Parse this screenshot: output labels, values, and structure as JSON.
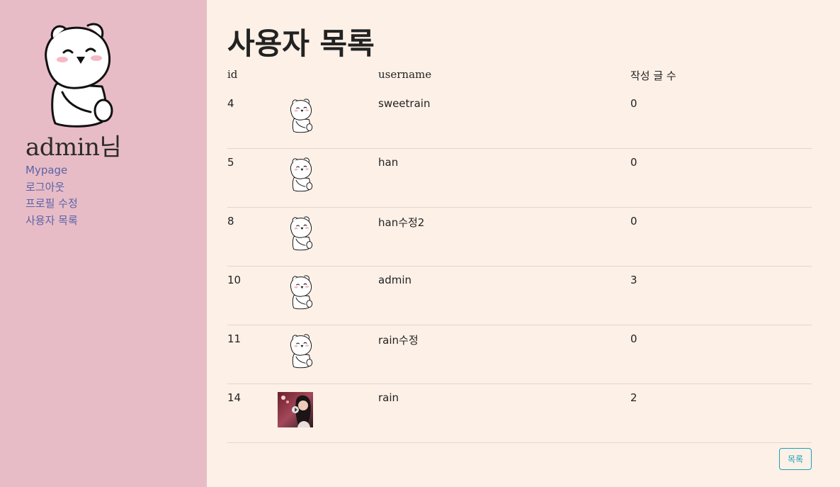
{
  "sidebar": {
    "admin_name": "admin님",
    "nav": [
      {
        "label": "Mypage"
      },
      {
        "label": "로그아웃"
      },
      {
        "label": "프로필 수정"
      },
      {
        "label": "사용자 목록"
      }
    ]
  },
  "main": {
    "title": "사용자 목록",
    "columns": {
      "id": "id",
      "username": "username",
      "count": "작성 글 수"
    },
    "rows": [
      {
        "id": "4",
        "image": "bear-icon",
        "username": "sweetrain",
        "count": "0"
      },
      {
        "id": "5",
        "image": "bear-icon",
        "username": "han",
        "count": "0"
      },
      {
        "id": "8",
        "image": "bear-icon",
        "username": "han수정2",
        "count": "0"
      },
      {
        "id": "10",
        "image": "bear-icon",
        "username": "admin",
        "count": "3"
      },
      {
        "id": "11",
        "image": "bear-icon",
        "username": "rain수정",
        "count": "0"
      },
      {
        "id": "14",
        "image": "photo-thumbnail",
        "username": "rain",
        "count": "2"
      }
    ],
    "list_button": "목록"
  },
  "colors": {
    "sidebar_bg": "#e8bcc6",
    "main_bg": "#fdf0e7",
    "link": "#5a63a8",
    "button": "#17a2b8"
  }
}
